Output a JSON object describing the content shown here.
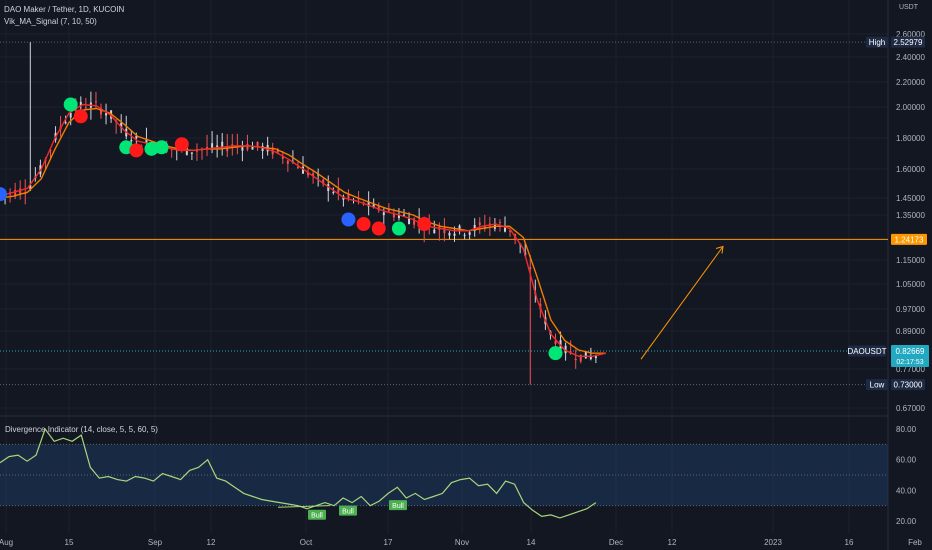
{
  "header": {
    "title": "DAO Maker / Tether, 1D, KUCOIN",
    "indicator1": "Vik_MA_Signal (7, 10, 50)",
    "indicator2": "Divergence Indicator (14, close, 5, 5, 60, 5)",
    "currency": "USDT"
  },
  "colors": {
    "background": "#131722",
    "up": "#26a69a",
    "down": "#ef5350",
    "wick_neutral": "#d1d4dc",
    "ma_orange": "#f57c00",
    "ma_red": "#ef2b2b",
    "signal_green": "#00e676",
    "signal_red": "#ff1a1a",
    "signal_blue": "#2962ff",
    "hline_orange": "#ff9800",
    "rsi_line": "#a5d67c",
    "rsi_band": "#1e3a5f",
    "label_dark": "#1e2a44",
    "label_teal": "#22a8c0"
  },
  "chart_data": [
    {
      "type": "candlestick",
      "symbol": "DAOUSDT",
      "price_scale": [
        0.67,
        2.6
      ],
      "y_ticks": [
        "2.60000",
        "2.40000",
        "2.20000",
        "2.00000",
        "1.80000",
        "1.60000",
        "1.45000",
        "1.35000",
        "1.15000",
        "1.05000",
        "0.97000",
        "0.89000",
        "0.77000",
        "0.67000"
      ],
      "x_ticks": [
        "Aug",
        "15",
        "Sep",
        "12",
        "Oct",
        "17",
        "Nov",
        "14",
        "Dec",
        "12",
        "2023",
        "16",
        "Feb"
      ],
      "labels": {
        "high_label": "High",
        "high_value": "2.52979",
        "low_label": "Low",
        "low_value": "0.73000",
        "current_symbol": "DAOUSDT",
        "current_value": "0.82669",
        "current_countdown": "02:17:53",
        "hline_value": "1.24173"
      },
      "ma_fast": [
        1.46,
        1.48,
        1.5,
        1.6,
        1.8,
        1.96,
        2.02,
        2.01,
        1.95,
        1.85,
        1.78,
        1.76,
        1.74,
        1.72,
        1.72,
        1.73,
        1.74,
        1.75,
        1.75,
        1.74,
        1.71,
        1.66,
        1.6,
        1.55,
        1.5,
        1.45,
        1.43,
        1.4,
        1.37,
        1.35,
        1.33,
        1.3,
        1.29,
        1.28,
        1.28,
        1.3,
        1.31,
        1.29,
        1.2,
        1.0,
        0.88,
        0.83,
        0.81,
        0.81,
        0.82
      ],
      "ma_slow": [
        1.45,
        1.46,
        1.48,
        1.55,
        1.73,
        1.9,
        1.98,
        1.99,
        1.96,
        1.89,
        1.81,
        1.78,
        1.75,
        1.73,
        1.72,
        1.73,
        1.73,
        1.74,
        1.75,
        1.74,
        1.73,
        1.69,
        1.63,
        1.58,
        1.53,
        1.48,
        1.45,
        1.42,
        1.39,
        1.37,
        1.35,
        1.32,
        1.3,
        1.29,
        1.28,
        1.29,
        1.3,
        1.3,
        1.25,
        1.08,
        0.93,
        0.86,
        0.83,
        0.82,
        0.82
      ],
      "signals": [
        {
          "date": "Aug",
          "price": 1.47,
          "kind": "neutral"
        },
        {
          "date": "Aug 22",
          "price": 2.02,
          "kind": "buy"
        },
        {
          "date": "Aug 24",
          "price": 1.94,
          "kind": "sell"
        },
        {
          "date": "Sep 2",
          "price": 1.74,
          "kind": "buy"
        },
        {
          "date": "Sep 4",
          "price": 1.72,
          "kind": "sell"
        },
        {
          "date": "Sep 7",
          "price": 1.73,
          "kind": "buy"
        },
        {
          "date": "Sep 9",
          "price": 1.74,
          "kind": "buy"
        },
        {
          "date": "Sep 13",
          "price": 1.76,
          "kind": "sell"
        },
        {
          "date": "Oct 16",
          "price": 1.33,
          "kind": "neutral"
        },
        {
          "date": "Oct 19",
          "price": 1.31,
          "kind": "sell"
        },
        {
          "date": "Oct 22",
          "price": 1.29,
          "kind": "sell"
        },
        {
          "date": "Oct 26",
          "price": 1.29,
          "kind": "buy"
        },
        {
          "date": "Oct 31",
          "price": 1.31,
          "kind": "sell"
        },
        {
          "date": "Nov 26",
          "price": 0.82,
          "kind": "buy"
        }
      ],
      "projection": {
        "from": 0.82,
        "to": 1.21
      }
    },
    {
      "type": "line",
      "name": "Divergence Indicator",
      "y_ticks": [
        "80.00",
        "60.00",
        "40.00",
        "20.00"
      ],
      "band": [
        30,
        70
      ],
      "levels": [
        30,
        50,
        70
      ],
      "values": [
        58,
        62,
        63,
        59,
        63,
        80,
        72,
        74,
        72,
        76,
        55,
        48,
        49,
        47,
        46,
        49,
        48,
        46,
        51,
        49,
        47,
        53,
        55,
        60,
        48,
        46,
        42,
        38,
        36,
        34,
        33,
        32,
        31,
        30,
        28,
        30,
        32,
        30,
        35,
        32,
        36,
        30,
        33,
        38,
        42,
        35,
        38,
        34,
        36,
        38,
        45,
        47,
        48,
        43,
        44,
        38,
        46,
        44,
        32,
        27,
        23,
        24,
        22,
        24,
        26,
        28,
        32
      ],
      "annotations": [
        "Bull",
        "Bull",
        "Bull"
      ]
    }
  ]
}
